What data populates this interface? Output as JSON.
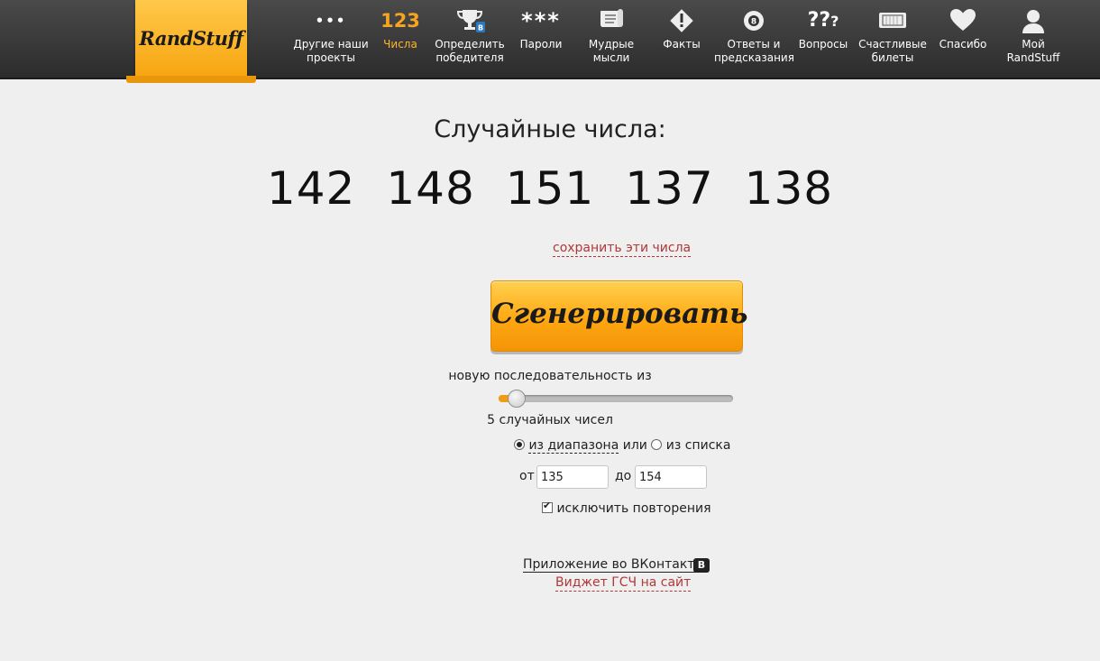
{
  "logo": {
    "text": "RandStuff"
  },
  "nav": [
    {
      "icon": "dots-icon",
      "glyph": "•••",
      "label": "Другие наши проекты"
    },
    {
      "icon": "numbers-123-icon",
      "glyph": "123",
      "label": "Числа",
      "active": true
    },
    {
      "icon": "trophy-icon",
      "glyph": "🏆",
      "label": "Определить победителя"
    },
    {
      "icon": "asterisks-icon",
      "glyph": "***",
      "label": "Пароли"
    },
    {
      "icon": "scroll-icon",
      "glyph": "📜",
      "label": "Мудрые мысли"
    },
    {
      "icon": "exclamation-icon",
      "glyph": "!",
      "label": "Факты"
    },
    {
      "icon": "magic-8-ball-icon",
      "glyph": "⑧",
      "label": "Ответы и предсказания"
    },
    {
      "icon": "question-marks-icon",
      "glyph": "???",
      "label": "Вопросы"
    },
    {
      "icon": "ticket-icon",
      "glyph": "▭",
      "label": "Счастливые билеты"
    },
    {
      "icon": "heart-icon",
      "glyph": "♥",
      "label": "Спасибо"
    },
    {
      "icon": "user-icon",
      "glyph": "👤",
      "label": "Мой RandStuff"
    }
  ],
  "main": {
    "title": "Случайные числа:",
    "numbers": [
      "142",
      "148",
      "151",
      "137",
      "138"
    ],
    "save_link": "сохранить эти числа",
    "generate_label": "Сгенерировать",
    "sequence_label": "новую последовательность из",
    "count_label": "5 случайных чисел",
    "mode_range": "из диапазона",
    "mode_or": "или",
    "mode_list": "из списка",
    "from_label": "от",
    "from_value": "135",
    "to_label": "до",
    "to_value": "154",
    "exclude_label": "исключить повторения",
    "vk_link": "Приложение во ВКонтакте",
    "vk_icon_letter": "В",
    "widget_link": "Виджет ГСЧ на сайт"
  }
}
